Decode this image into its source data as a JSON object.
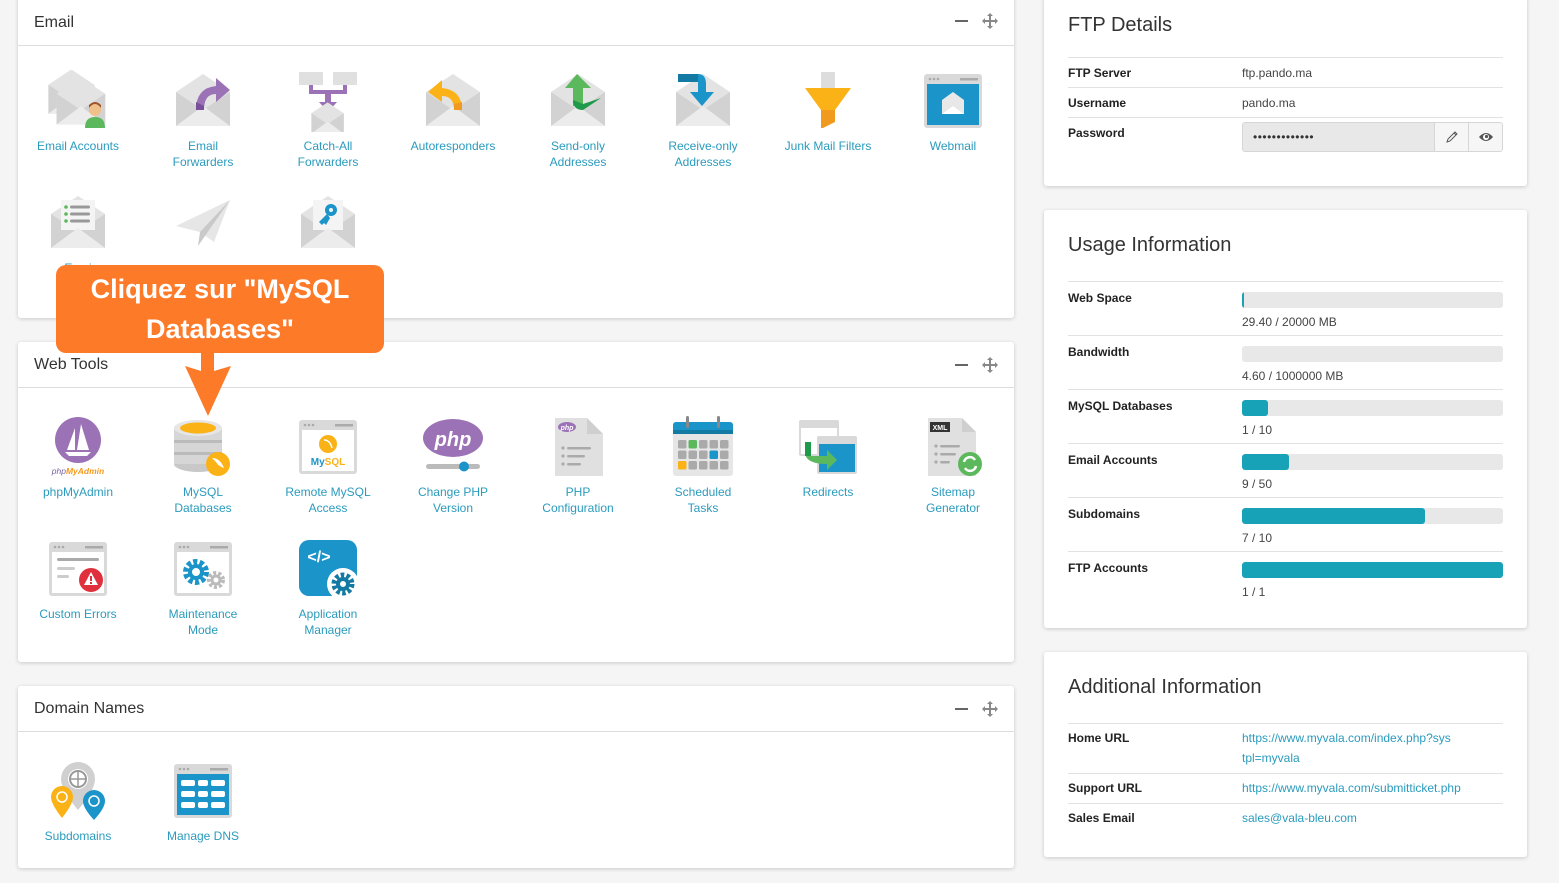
{
  "email_panel": {
    "title": "Email",
    "items": [
      {
        "label": "Email Accounts",
        "icon": "email-accounts-icon"
      },
      {
        "label": "Email Forwarders",
        "icon": "email-forwarders-icon"
      },
      {
        "label": "Catch-All Forwarders",
        "icon": "catch-all-forwarders-icon"
      },
      {
        "label": "Autoresponders",
        "icon": "autoresponders-icon"
      },
      {
        "label": "Send-only Addresses",
        "icon": "send-only-icon"
      },
      {
        "label": "Receive-only Addresses",
        "icon": "receive-only-icon"
      },
      {
        "label": "Junk Mail Filters",
        "icon": "junk-filter-icon"
      },
      {
        "label": "Webmail",
        "icon": "webmail-icon"
      },
      {
        "label": "Emai",
        "icon": "mailing-list-icon"
      },
      {
        "label": "",
        "icon": "paper-plane-icon"
      },
      {
        "label": "",
        "icon": "email-key-icon"
      }
    ]
  },
  "web_tools_panel": {
    "title": "Web Tools",
    "items": [
      {
        "label": "phpMyAdmin",
        "icon": "phpmyadmin-icon"
      },
      {
        "label": "MySQL Databases",
        "icon": "mysql-database-icon"
      },
      {
        "label": "Remote MySQL Access",
        "icon": "remote-mysql-icon"
      },
      {
        "label": "Change PHP Version",
        "icon": "php-version-icon"
      },
      {
        "label": "PHP Configuration",
        "icon": "php-config-icon"
      },
      {
        "label": "Scheduled Tasks",
        "icon": "calendar-icon"
      },
      {
        "label": "Redirects",
        "icon": "redirects-icon"
      },
      {
        "label": "Sitemap Generator",
        "icon": "sitemap-icon"
      },
      {
        "label": "Custom Errors",
        "icon": "custom-errors-icon"
      },
      {
        "label": "Maintenance Mode",
        "icon": "maintenance-icon"
      },
      {
        "label": "Application Manager",
        "icon": "app-manager-icon"
      }
    ]
  },
  "domain_panel": {
    "title": "Domain Names",
    "items": [
      {
        "label": "Subdomains",
        "icon": "subdomains-icon"
      },
      {
        "label": "Manage DNS",
        "icon": "dns-icon"
      }
    ]
  },
  "callout": {
    "text": "Cliquez sur \"MySQL Databases\"",
    "color": "#fd7a29"
  },
  "ftp": {
    "title": "FTP Details",
    "rows": [
      {
        "key": "FTP Server",
        "value": "ftp.pando.ma"
      },
      {
        "key": "Username",
        "value": "pando.ma"
      },
      {
        "key": "Password",
        "value": "•••••••••••••"
      }
    ]
  },
  "usage": {
    "title": "Usage Information",
    "accent": "#17a2b8",
    "rows": [
      {
        "key": "Web Space",
        "used": 29.4,
        "limit": 20000,
        "fraction": 0.00147,
        "label": "29.40 / 20000 MB"
      },
      {
        "key": "Bandwidth",
        "used": 4.6,
        "limit": 1000000,
        "fraction": 0.0,
        "label": "4.60 / 1000000 MB"
      },
      {
        "key": "MySQL Databases",
        "used": 1,
        "limit": 10,
        "fraction": 0.1,
        "label": "1 / 10"
      },
      {
        "key": "Email Accounts",
        "used": 9,
        "limit": 50,
        "fraction": 0.18,
        "label": "9 / 50"
      },
      {
        "key": "Subdomains",
        "used": 7,
        "limit": 10,
        "fraction": 0.7,
        "label": "7 / 10"
      },
      {
        "key": "FTP Accounts",
        "used": 1,
        "limit": 1,
        "fraction": 1.0,
        "label": "1 / 1"
      }
    ]
  },
  "additional": {
    "title": "Additional Information",
    "rows": [
      {
        "key": "Home URL",
        "value": "https://www.myvala.com/index.php?systpl=myvala"
      },
      {
        "key": "Support URL",
        "value": "https://www.myvala.com/submitticket.php"
      },
      {
        "key": "Sales Email",
        "value": "sales@vala-bleu.com"
      }
    ]
  }
}
